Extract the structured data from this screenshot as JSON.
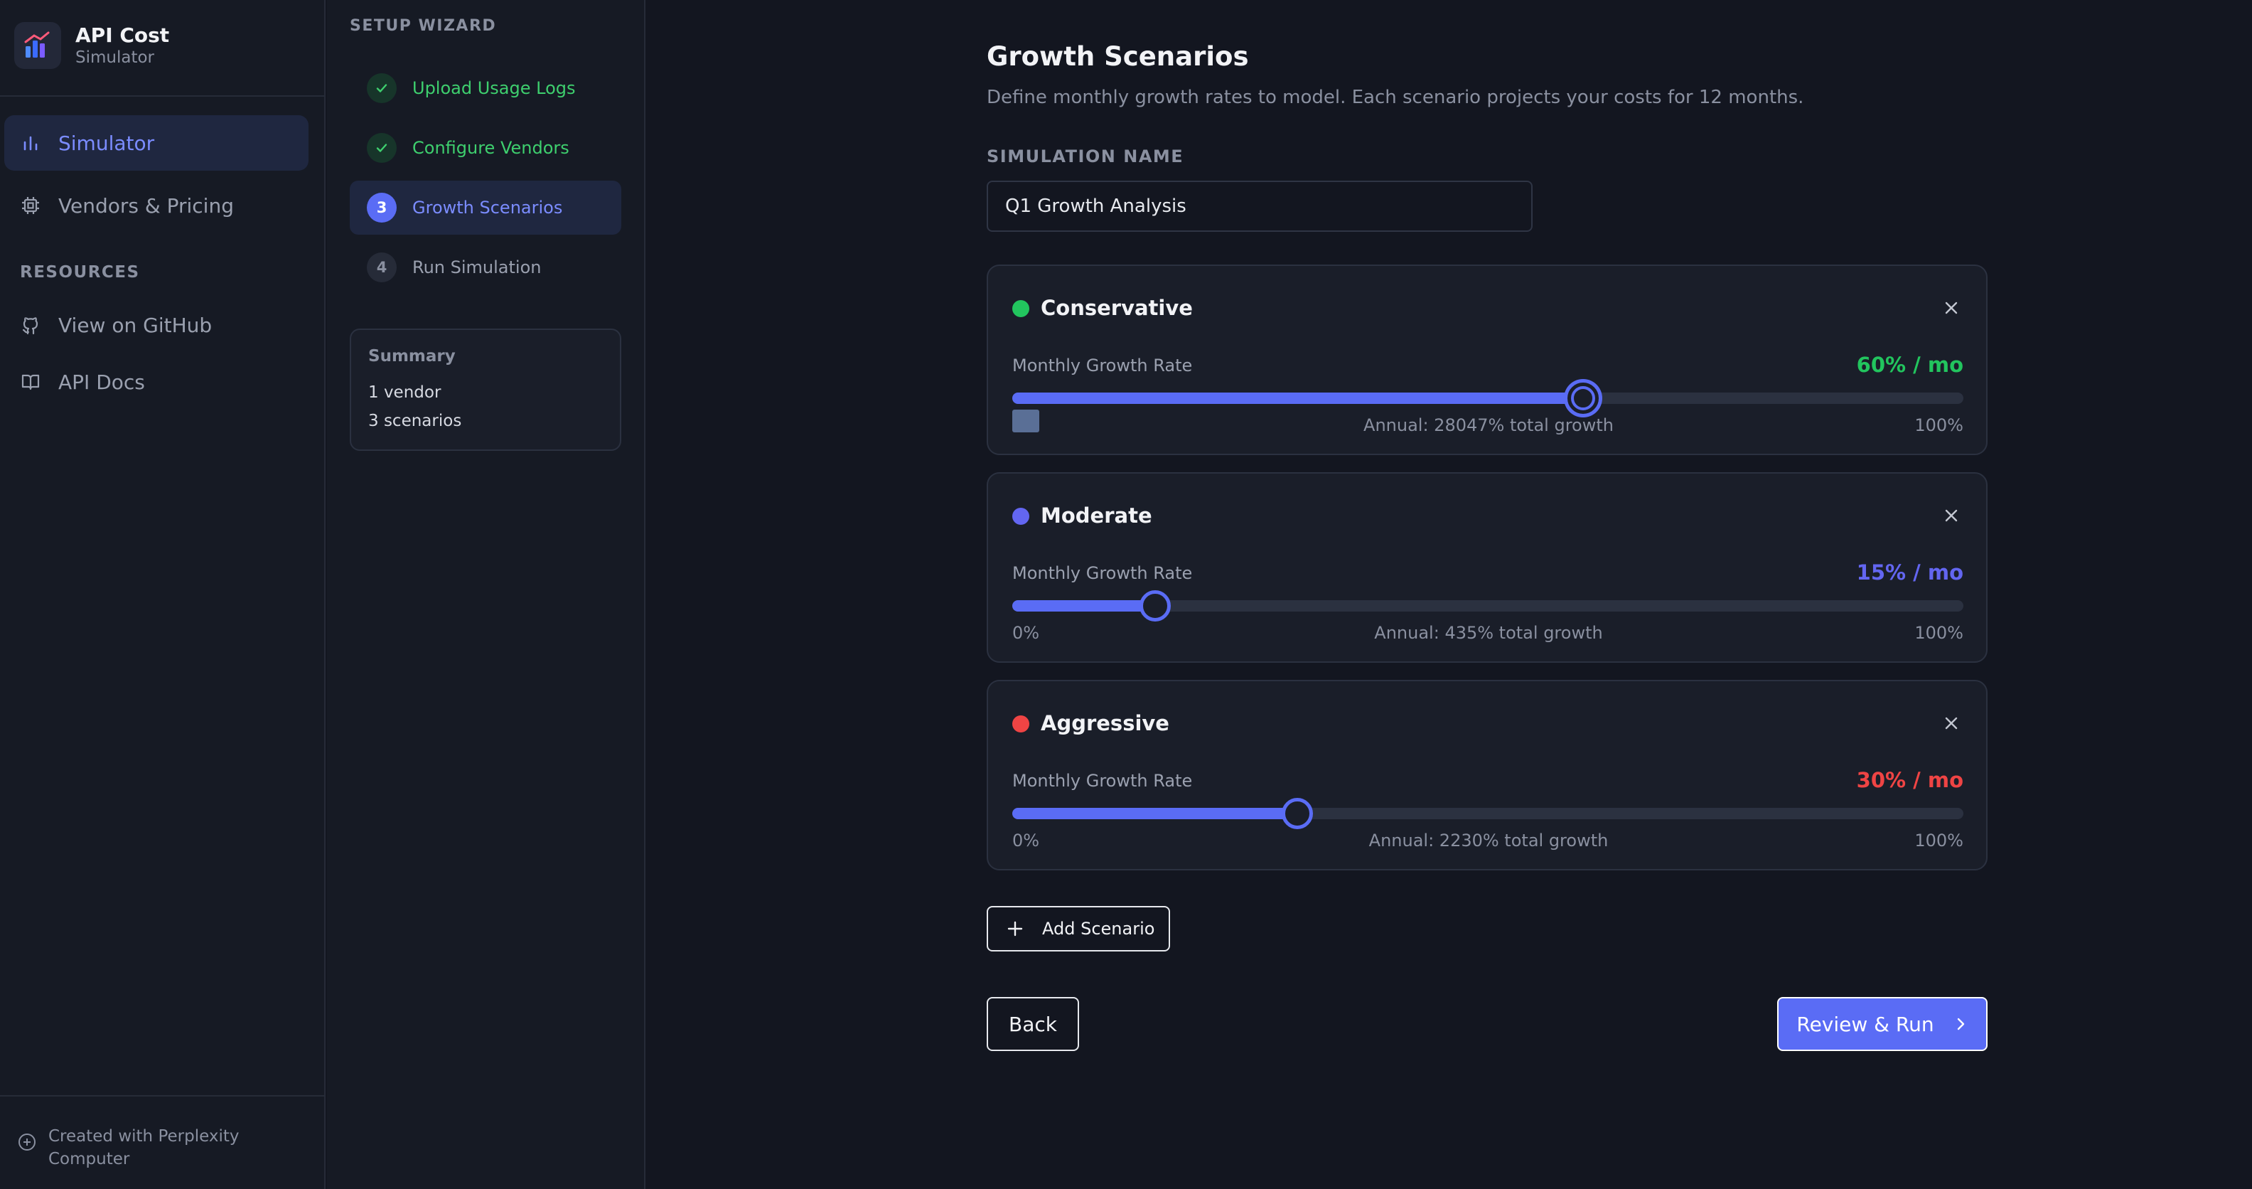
{
  "brand": {
    "title": "API Cost",
    "subtitle": "Simulator",
    "icon": "bar-chart-logo-icon"
  },
  "nav": {
    "items": [
      {
        "label": "Simulator",
        "icon": "bar-chart-icon",
        "active": true
      },
      {
        "label": "Vendors & Pricing",
        "icon": "chip-icon",
        "active": false
      }
    ],
    "resources_label": "RESOURCES",
    "resources": [
      {
        "label": "View on GitHub",
        "icon": "github-icon"
      },
      {
        "label": "API Docs",
        "icon": "book-icon"
      }
    ],
    "footer": "Created with Perplexity Computer"
  },
  "wizard": {
    "label": "SETUP WIZARD",
    "steps": [
      {
        "number": "1",
        "label": "Upload Usage Logs",
        "state": "done"
      },
      {
        "number": "2",
        "label": "Configure Vendors",
        "state": "done"
      },
      {
        "number": "3",
        "label": "Growth Scenarios",
        "state": "current"
      },
      {
        "number": "4",
        "label": "Run Simulation",
        "state": "pending"
      }
    ],
    "summary": {
      "title": "Summary",
      "vendors": "1 vendor",
      "scenarios": "3 scenarios"
    }
  },
  "main": {
    "title": "Growth Scenarios",
    "subtitle": "Define monthly growth rates to model. Each scenario projects your costs for 12 months.",
    "sim_name_label": "SIMULATION NAME",
    "sim_name_value": "Q1 Growth Analysis",
    "scenarios": [
      {
        "name": "Conservative",
        "color": "#22c55e",
        "rate_label": "Monthly Growth Rate",
        "rate_value": "60% / mo",
        "rate_percent": 60,
        "min": "0%",
        "max": "100%",
        "annual": "Annual: 28047% total growth",
        "focused": true
      },
      {
        "name": "Moderate",
        "color": "#6366f1",
        "rate_label": "Monthly Growth Rate",
        "rate_value": "15% / mo",
        "rate_percent": 15,
        "min": "0%",
        "max": "100%",
        "annual": "Annual: 435% total growth",
        "focused": false
      },
      {
        "name": "Aggressive",
        "color": "#ef4444",
        "rate_label": "Monthly Growth Rate",
        "rate_value": "30% / mo",
        "rate_percent": 30,
        "min": "0%",
        "max": "100%",
        "annual": "Annual: 2230% total growth",
        "focused": false
      }
    ],
    "add_scenario": "Add Scenario",
    "back": "Back",
    "review_run": "Review & Run"
  }
}
